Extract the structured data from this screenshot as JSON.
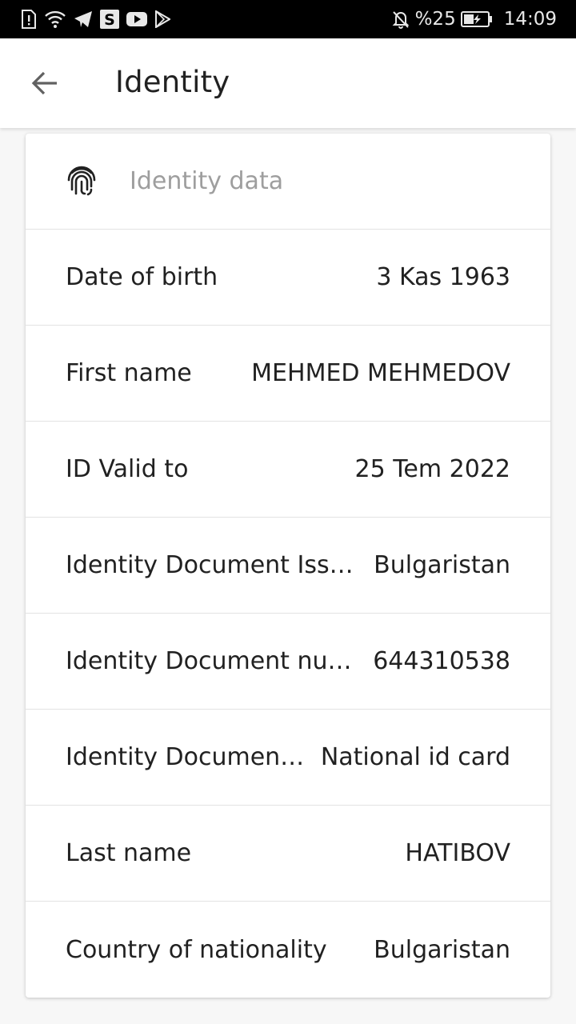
{
  "status_bar": {
    "battery_percent": "%25",
    "time": "14:09",
    "left_icons": [
      "sim-alert-icon",
      "wifi-icon",
      "telegram-icon",
      "s-app-icon",
      "youtube-icon",
      "play-store-icon"
    ],
    "right_icons": [
      "notifications-off-icon",
      "battery-charging-icon"
    ]
  },
  "app_bar": {
    "title": "Identity",
    "back_icon": "arrow-back-icon"
  },
  "card": {
    "header_icon": "fingerprint-icon",
    "header_title": "Identity data",
    "rows": [
      {
        "label": "Date of birth",
        "value": "3 Kas 1963"
      },
      {
        "label": "First name",
        "value": "MEHMED MEHMEDOV"
      },
      {
        "label": "ID Valid to",
        "value": "25 Tem 2022"
      },
      {
        "label": "Identity Document Issu…",
        "value": "Bulgaristan"
      },
      {
        "label": "Identity Document num…",
        "value": "644310538"
      },
      {
        "label": "Identity Document…",
        "value": "National id card"
      },
      {
        "label": "Last name",
        "value": "HATIBOV"
      },
      {
        "label": "Country of nationality",
        "value": "Bulgaristan"
      }
    ]
  },
  "colors": {
    "status_bar_bg": "#000000",
    "app_bar_bg": "#ffffff",
    "page_bg": "#f7f7f7",
    "primary_text": "#212121",
    "secondary_text": "#9e9e9e",
    "divider": "#e3e3e3"
  }
}
